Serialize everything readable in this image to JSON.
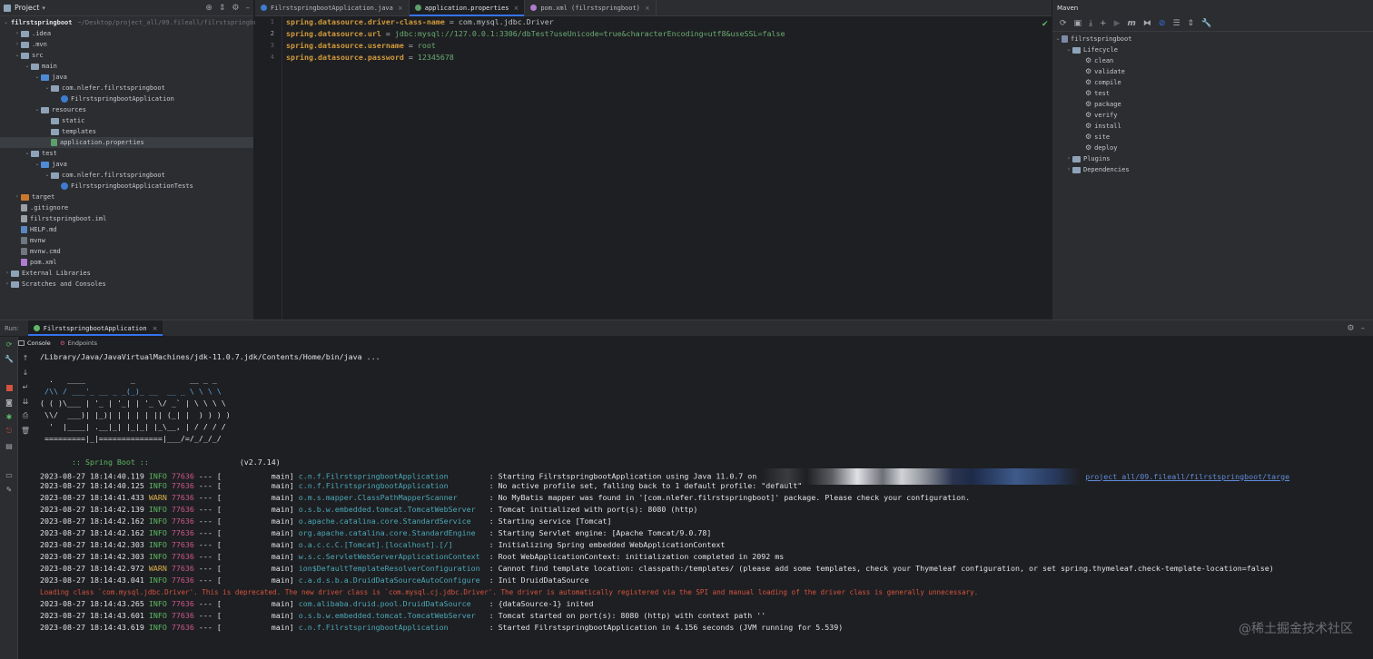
{
  "project": {
    "header_title": "Project",
    "root_name": "filrstspringboot",
    "root_path": "~/Desktop/project_all/09.fileall/filrstspringboot",
    "items": [
      {
        "depth": 1,
        "label": ".idea",
        "kind": "folder",
        "chevron": "›"
      },
      {
        "depth": 1,
        "label": ".mvn",
        "kind": "folder",
        "chevron": "›"
      },
      {
        "depth": 1,
        "label": "src",
        "kind": "folder",
        "chevron": "⌄"
      },
      {
        "depth": 2,
        "label": "main",
        "kind": "folder",
        "chevron": "⌄"
      },
      {
        "depth": 3,
        "label": "java",
        "kind": "folder-blue",
        "chevron": "⌄"
      },
      {
        "depth": 4,
        "label": "com.nlefer.filrstspringboot",
        "kind": "package",
        "chevron": "⌄"
      },
      {
        "depth": 5,
        "label": "FilrstspringbootApplication",
        "kind": "class",
        "chevron": ""
      },
      {
        "depth": 3,
        "label": "resources",
        "kind": "folder",
        "chevron": "⌄"
      },
      {
        "depth": 4,
        "label": "static",
        "kind": "folder",
        "chevron": ""
      },
      {
        "depth": 4,
        "label": "templates",
        "kind": "folder",
        "chevron": ""
      },
      {
        "depth": 4,
        "label": "application.properties",
        "kind": "properties",
        "chevron": "",
        "selected": true
      },
      {
        "depth": 2,
        "label": "test",
        "kind": "folder",
        "chevron": "⌄"
      },
      {
        "depth": 3,
        "label": "java",
        "kind": "folder-blue",
        "chevron": "⌄"
      },
      {
        "depth": 4,
        "label": "com.nlefer.filrstspringboot",
        "kind": "package",
        "chevron": "⌄"
      },
      {
        "depth": 5,
        "label": "FilrstspringbootApplicationTests",
        "kind": "class",
        "chevron": ""
      },
      {
        "depth": 1,
        "label": "target",
        "kind": "folder-orange",
        "chevron": "›"
      },
      {
        "depth": 1,
        "label": ".gitignore",
        "kind": "file",
        "chevron": ""
      },
      {
        "depth": 1,
        "label": "filrstspringboot.iml",
        "kind": "file",
        "chevron": ""
      },
      {
        "depth": 1,
        "label": "HELP.md",
        "kind": "md",
        "chevron": ""
      },
      {
        "depth": 1,
        "label": "mvnw",
        "kind": "cmd",
        "chevron": ""
      },
      {
        "depth": 1,
        "label": "mvnw.cmd",
        "kind": "cmd",
        "chevron": ""
      },
      {
        "depth": 1,
        "label": "pom.xml",
        "kind": "xml",
        "chevron": ""
      },
      {
        "depth": 0,
        "label": "External Libraries",
        "kind": "folder",
        "chevron": "›"
      },
      {
        "depth": 0,
        "label": "Scratches and Consoles",
        "kind": "folder",
        "chevron": "›"
      }
    ]
  },
  "editor": {
    "tabs": [
      {
        "label": "FilrstspringbootApplication.java",
        "active": false,
        "color": "#3e7ccf"
      },
      {
        "label": "application.properties",
        "active": true,
        "color": "#5e9e6a"
      },
      {
        "label": "pom.xml (filrstspringboot)",
        "active": false,
        "color": "#b07cd0"
      }
    ],
    "lines": [
      {
        "num": "1",
        "key": "spring.datasource.driver-class-name",
        "sep": " = ",
        "value": "com.mysql.jdbc.Driver",
        "value_plain": true
      },
      {
        "num": "2",
        "key": "spring.datasource.url",
        "sep": " = ",
        "value": "jdbc:mysql://127.0.0.1:3306/dbTest?useUnicode=true&characterEncoding=utf8&useSSL=false",
        "value_plain": false
      },
      {
        "num": "3",
        "key": "spring.datasource.username",
        "sep": " = ",
        "value": "root",
        "value_plain": false
      },
      {
        "num": "4",
        "key": "spring.datasource.password",
        "sep": " = ",
        "value": "12345678",
        "value_plain": false
      }
    ]
  },
  "maven": {
    "header_title": "Maven",
    "root": "filrstspringboot",
    "lifecycle_label": "Lifecycle",
    "phases": [
      "clean",
      "validate",
      "compile",
      "test",
      "package",
      "verify",
      "install",
      "site",
      "deploy"
    ],
    "plugins_label": "Plugins",
    "dependencies_label": "Dependencies"
  },
  "run": {
    "label": "Run:",
    "tab_label": "FilrstspringbootApplication",
    "console_tab": "Console",
    "endpoints_tab": "Endpoints",
    "java_cmd": "/Library/Java/JavaVirtualMachines/jdk-11.0.7.jdk/Contents/Home/bin/java ...",
    "banner": [
      "  .   ____          _            __ _ _",
      " /\\\\ / ___'_ __ _ _(_)_ __  __ _ \\ \\ \\ \\",
      "( ( )\\___ | '_ | '_| | '_ \\/ _` | \\ \\ \\ \\",
      " \\\\/  ___)| |_)| | | | | || (_| |  ) ) ) )",
      "  '  |____| .__|_| |_|_| |_\\__, | / / / /",
      " =========|_|==============|___/=/_/_/_/"
    ],
    "spring_boot_label": " :: Spring Boot ::",
    "spring_boot_version": "(v2.7.14)",
    "logs": [
      {
        "ts": "2023-08-27 18:14:40.119",
        "level": "INFO",
        "pid": "77636",
        "thread": "--- [           main]",
        "logger": "c.n.f.FilrstspringbootApplication       ",
        "msg": " : Starting FilrstspringbootApplication using Java 11.0.7 on",
        "link": "project_all/09.fileall/filrstspringboot/targe"
      },
      {
        "ts": "2023-08-27 18:14:40.125",
        "level": "INFO",
        "pid": "77636",
        "thread": "--- [           main]",
        "logger": "c.n.f.FilrstspringbootApplication       ",
        "msg": " : No active profile set, falling back to 1 default profile: \"default\""
      },
      {
        "ts": "2023-08-27 18:14:41.433",
        "level": "WARN",
        "pid": "77636",
        "thread": "--- [           main]",
        "logger": "o.m.s.mapper.ClassPathMapperScanner     ",
        "msg": " : No MyBatis mapper was found in '[com.nlefer.filrstspringboot]' package. Please check your configuration."
      },
      {
        "ts": "2023-08-27 18:14:42.139",
        "level": "INFO",
        "pid": "77636",
        "thread": "--- [           main]",
        "logger": "o.s.b.w.embedded.tomcat.TomcatWebServer ",
        "msg": " : Tomcat initialized with port(s): 8080 (http)"
      },
      {
        "ts": "2023-08-27 18:14:42.162",
        "level": "INFO",
        "pid": "77636",
        "thread": "--- [           main]",
        "logger": "o.apache.catalina.core.StandardService  ",
        "msg": " : Starting service [Tomcat]"
      },
      {
        "ts": "2023-08-27 18:14:42.162",
        "level": "INFO",
        "pid": "77636",
        "thread": "--- [           main]",
        "logger": "org.apache.catalina.core.StandardEngine ",
        "msg": " : Starting Servlet engine: [Apache Tomcat/9.0.78]"
      },
      {
        "ts": "2023-08-27 18:14:42.303",
        "level": "INFO",
        "pid": "77636",
        "thread": "--- [           main]",
        "logger": "o.a.c.c.C.[Tomcat].[localhost].[/]      ",
        "msg": " : Initializing Spring embedded WebApplicationContext"
      },
      {
        "ts": "2023-08-27 18:14:42.303",
        "level": "INFO",
        "pid": "77636",
        "thread": "--- [           main]",
        "logger": "w.s.c.ServletWebServerApplicationContext",
        "msg": " : Root WebApplicationContext: initialization completed in 2092 ms"
      },
      {
        "ts": "2023-08-27 18:14:42.972",
        "level": "WARN",
        "pid": "77636",
        "thread": "--- [           main]",
        "logger": "ion$DefaultTemplateResolverConfiguration",
        "msg": " : Cannot find template location: classpath:/templates/ (please add some templates, check your Thymeleaf configuration, or set spring.thymeleaf.check-template-location=false)"
      },
      {
        "ts": "2023-08-27 18:14:43.041",
        "level": "INFO",
        "pid": "77636",
        "thread": "--- [           main]",
        "logger": "c.a.d.s.b.a.DruidDataSourceAutoConfigure",
        "msg": " : Init DruidDataSource"
      },
      {
        "error": "Loading class `com.mysql.jdbc.Driver'. This is deprecated. The new driver class is `com.mysql.cj.jdbc.Driver'. The driver is automatically registered via the SPI and manual loading of the driver class is generally unnecessary."
      },
      {
        "ts": "2023-08-27 18:14:43.265",
        "level": "INFO",
        "pid": "77636",
        "thread": "--- [           main]",
        "logger": "com.alibaba.druid.pool.DruidDataSource  ",
        "msg": " : {dataSource-1} inited"
      },
      {
        "ts": "2023-08-27 18:14:43.601",
        "level": "INFO",
        "pid": "77636",
        "thread": "--- [           main]",
        "logger": "o.s.b.w.embedded.tomcat.TomcatWebServer ",
        "msg": " : Tomcat started on port(s): 8080 (http) with context path ''"
      },
      {
        "ts": "2023-08-27 18:14:43.619",
        "level": "INFO",
        "pid": "77636",
        "thread": "--- [           main]",
        "logger": "c.n.f.FilrstspringbootApplication       ",
        "msg": " : Started FilrstspringbootApplication in 4.156 seconds (JVM running for 5.539)"
      }
    ]
  },
  "watermark": "@稀土掘金技术社区"
}
